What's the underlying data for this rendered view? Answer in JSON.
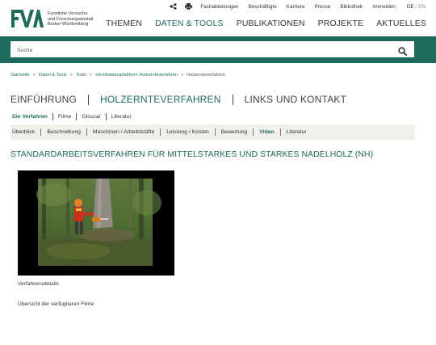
{
  "logo": {
    "mark": "FVA",
    "text_lines": [
      "Forstliche Versuchs-",
      "und Forschungsanstalt",
      "Baden-Württemberg"
    ]
  },
  "topbar": {
    "icons": [
      "share-icon",
      "print-icon"
    ],
    "links": [
      "Fachabteilungen",
      "Beschäftigte",
      "Karriere",
      "Presse",
      "Bibliothek",
      "Anmelden"
    ],
    "lang_de": "DE",
    "lang_sep": "/",
    "lang_en": "EN"
  },
  "mainnav": {
    "items": [
      "THEMEN",
      "DATEN & TOOLS",
      "PUBLIKATIONEN",
      "PROJEKTE",
      "AKTUELLES"
    ],
    "active": "DATEN & TOOLS"
  },
  "search": {
    "placeholder": "Suche",
    "icon": "search-icon"
  },
  "breadcrumb": {
    "items": [
      "Startseite",
      "Daten & Tools",
      "Tools",
      "Informationsplattform Holzernteverfahren",
      "Holzernteverfahren"
    ],
    "separator": ">"
  },
  "section_tabs": {
    "items": [
      "EINFÜHRUNG",
      "HOLZERNTEVERFAHREN",
      "LINKS UND KONTAKT"
    ],
    "active": "HOLZERNTEVERFAHREN"
  },
  "sub_tabs": {
    "items": [
      "Die Verfahren",
      "Filme",
      "Glossar",
      "Literatur"
    ],
    "active": "Die Verfahren"
  },
  "detail_nav": {
    "items": [
      "Überblick",
      "Beschreibung",
      "Maschinen / Arbeitskräfte",
      "Leistung / Kosten",
      "Bewertung",
      "Video",
      "Literatur"
    ],
    "active": "Video"
  },
  "page_title": "STANDARDARBEITSVERFAHREN FÜR MITTELSTARKES UND STARKES NADELHOLZ (NH)",
  "links": {
    "details": "Verfahrensdetails",
    "films": "Übersicht der verfügbaren Filme"
  },
  "colors": {
    "brand_green": "#1c6b5c",
    "link_green": "#1b6b5e",
    "nav_bg": "#f1efea"
  }
}
